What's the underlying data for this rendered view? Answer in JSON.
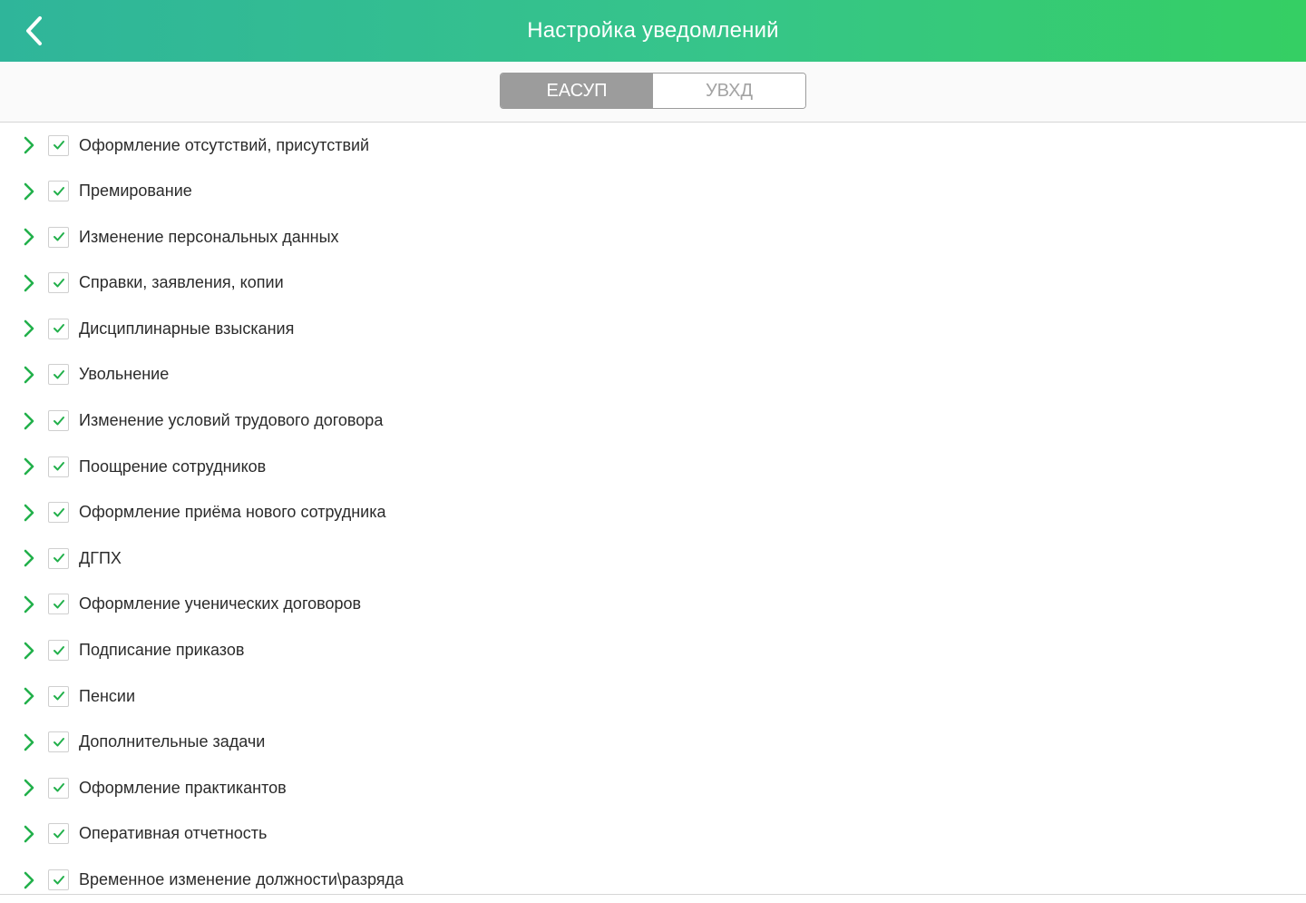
{
  "header": {
    "title": "Настройка уведомлений",
    "back_icon": "chevron-left-icon"
  },
  "segments": [
    {
      "label": "ЕАСУП",
      "selected": true
    },
    {
      "label": "УВХД",
      "selected": false
    }
  ],
  "colors": {
    "header_gradient_start": "#2fb59a",
    "header_gradient_end": "#35cf63",
    "accent_green": "#22b04b",
    "segment_active": "#9c9c9c"
  },
  "items": [
    {
      "label": "Оформление отсутствий, присутствий",
      "checked": true
    },
    {
      "label": "Премирование",
      "checked": true
    },
    {
      "label": "Изменение персональных данных",
      "checked": true
    },
    {
      "label": "Справки, заявления, копии",
      "checked": true
    },
    {
      "label": "Дисциплинарные взыскания",
      "checked": true
    },
    {
      "label": "Увольнение",
      "checked": true
    },
    {
      "label": "Изменение условий трудового договора",
      "checked": true
    },
    {
      "label": "Поощрение сотрудников",
      "checked": true
    },
    {
      "label": "Оформление приёма нового сотрудника",
      "checked": true
    },
    {
      "label": "ДГПХ",
      "checked": true
    },
    {
      "label": "Оформление ученических договоров",
      "checked": true
    },
    {
      "label": "Подписание приказов",
      "checked": true
    },
    {
      "label": "Пенсии",
      "checked": true
    },
    {
      "label": "Дополнительные задачи",
      "checked": true
    },
    {
      "label": "Оформление практикантов",
      "checked": true
    },
    {
      "label": "Оперативная отчетность",
      "checked": true
    },
    {
      "label": "Временное изменение должности\\разряда",
      "checked": true
    }
  ]
}
